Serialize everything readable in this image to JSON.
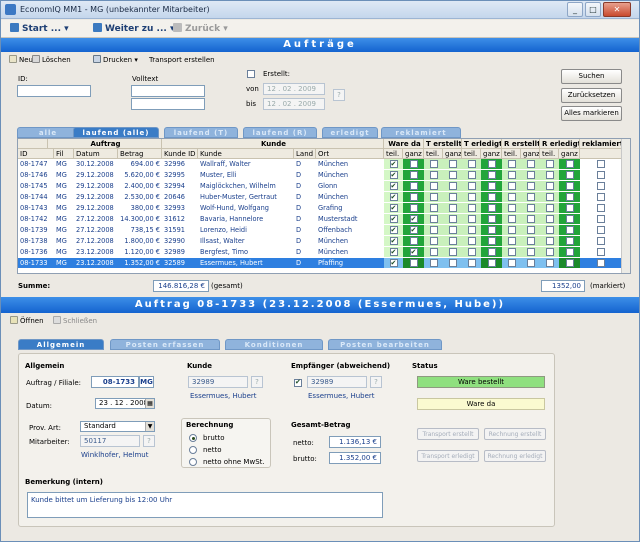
{
  "window": {
    "title": "EconomIQ MM1 - MG (unbekannter Mitarbeiter)",
    "min": "_",
    "max": "□",
    "close": "✕"
  },
  "nav": {
    "start": "Start ...",
    "weiter": "Weiter zu ...",
    "zurueck": "Zurück"
  },
  "band1": "Aufträge",
  "toolbar": {
    "neu": "Neu",
    "loeschen": "Löschen",
    "drucken": "Drucken",
    "transport": "Transport erstellen"
  },
  "filter": {
    "id_label": "ID:",
    "volltext_label": "Volltext",
    "erstellt_label": "Erstellt:",
    "von_label": "von",
    "bis_label": "bis",
    "von_value": "12 . 02 . 2009",
    "bis_value": "12 . 02 . 2009",
    "q": "?",
    "suchen": "Suchen",
    "zuruecksetzen": "Zurücksetzen",
    "alle_markieren": "Alles markieren"
  },
  "tabs": [
    "alle",
    "laufend (alle)",
    "laufend (T)",
    "laufend (R)",
    "erledigt",
    "reklamiert"
  ],
  "grid": {
    "groups": {
      "auftrag": "Auftrag",
      "kunde": "Kunde",
      "ware_da": "Ware da",
      "terstellt": "T erstellt",
      "terledigt": "T erledigt",
      "rerstellt": "R erstellt",
      "rerledigt": "R erledigt",
      "reklamiert": "reklamiert"
    },
    "cols": {
      "id": "ID",
      "fil": "Fil",
      "datum": "Datum",
      "betrag": "Betrag",
      "kunde_id": "Kunde ID",
      "kunde": "Kunde",
      "land": "Land",
      "ort": "Ort",
      "teil": "teil.",
      "ganz": "ganz",
      "teil2": "teil."
    },
    "rows": [
      {
        "id": "08-1747",
        "fil": "MG",
        "datum": "30.12.2008",
        "betrag": "694.00 €",
        "kid": "32996",
        "kunde": "Wallraff, Walter",
        "land": "D",
        "ort": "München",
        "checks": [
          1,
          0,
          0,
          0,
          0,
          0,
          0,
          0,
          0,
          0,
          0
        ],
        "sel": false
      },
      {
        "id": "08-1746",
        "fil": "MG",
        "datum": "29.12.2008",
        "betrag": "5.620,00 €",
        "kid": "32995",
        "kunde": "Muster, Elli",
        "land": "D",
        "ort": "München",
        "checks": [
          1,
          0,
          0,
          0,
          0,
          0,
          0,
          0,
          0,
          0,
          0
        ],
        "sel": false
      },
      {
        "id": "08-1745",
        "fil": "MG",
        "datum": "29.12.2008",
        "betrag": "2.400,00 €",
        "kid": "32994",
        "kunde": "Maiglöckchen, Wilhelm",
        "land": "D",
        "ort": "Glonn",
        "checks": [
          1,
          0,
          0,
          0,
          0,
          0,
          0,
          0,
          0,
          0,
          0
        ],
        "sel": false
      },
      {
        "id": "08-1744",
        "fil": "MG",
        "datum": "29.12.2008",
        "betrag": "2.530,00 €",
        "kid": "20646",
        "kunde": "Huber-Muster, Gertraut",
        "land": "D",
        "ort": "München",
        "checks": [
          1,
          0,
          0,
          0,
          0,
          0,
          0,
          0,
          0,
          0,
          0
        ],
        "sel": false
      },
      {
        "id": "08-1743",
        "fil": "MG",
        "datum": "29.12.2008",
        "betrag": "380,00 €",
        "kid": "32993",
        "kunde": "Wolf-Hund, Wolfgang",
        "land": "D",
        "ort": "Grafing",
        "checks": [
          1,
          0,
          0,
          0,
          0,
          0,
          0,
          0,
          0,
          0,
          0
        ],
        "sel": false
      },
      {
        "id": "08-1742",
        "fil": "MG",
        "datum": "27.12.2008",
        "betrag": "14.300,00 €",
        "kid": "31612",
        "kunde": "Bavaria, Hannelore",
        "land": "D",
        "ort": "Musterstadt",
        "checks": [
          1,
          1,
          0,
          0,
          0,
          0,
          0,
          0,
          0,
          0,
          0
        ],
        "sel": false
      },
      {
        "id": "08-1739",
        "fil": "MG",
        "datum": "27.12.2008",
        "betrag": "738,15 €",
        "kid": "31591",
        "kunde": "Lorenzo, Heidi",
        "land": "D",
        "ort": "Offenbach",
        "checks": [
          1,
          1,
          0,
          0,
          0,
          0,
          0,
          0,
          0,
          0,
          0
        ],
        "sel": false
      },
      {
        "id": "08-1738",
        "fil": "MG",
        "datum": "27.12.2008",
        "betrag": "1.800,00 €",
        "kid": "32990",
        "kunde": "Illsast, Walter",
        "land": "D",
        "ort": "München",
        "checks": [
          1,
          0,
          0,
          0,
          0,
          0,
          0,
          0,
          0,
          0,
          0
        ],
        "sel": false
      },
      {
        "id": "08-1736",
        "fil": "MG",
        "datum": "23.12.2008",
        "betrag": "1.120,00 €",
        "kid": "32989",
        "kunde": "Bergfest, Timo",
        "land": "D",
        "ort": "München",
        "checks": [
          1,
          1,
          0,
          0,
          0,
          0,
          0,
          0,
          0,
          0,
          0
        ],
        "sel": false
      },
      {
        "id": "08-1733",
        "fil": "MG",
        "datum": "23.12.2008",
        "betrag": "1.352,00 €",
        "kid": "32589",
        "kunde": "Essermues, Hubert",
        "land": "D",
        "ort": "Pfaffing",
        "checks": [
          1,
          0,
          0,
          0,
          0,
          0,
          0,
          0,
          0,
          0,
          0
        ],
        "sel": true
      }
    ]
  },
  "summe": {
    "label": "Summe:",
    "value": "146.816,28 €",
    "gesamt": "(gesamt)",
    "marked_value": "1352,00",
    "markiert": "(markiert)"
  },
  "band2": "Auftrag 08-1733 (23.12.2008 (Essermues, Hube))",
  "toolbar2": {
    "oeffnen": "Öffnen",
    "schliessen": "Schließen"
  },
  "tabs2": [
    "Allgemein",
    "Posten erfassen",
    "Konditionen",
    "Posten bearbeiten"
  ],
  "detail": {
    "allgemein": "Allgemein",
    "auftrag_label": "Auftrag / Filiale:",
    "auftrag_id": "08-1733",
    "filiale": "MG",
    "datum_label": "Datum:",
    "datum_value": "23 . 12 . 2008",
    "prov_label": "Prov. Art:",
    "prov_value": "Standard",
    "mitarbeiter_label": "Mitarbeiter:",
    "mitarbeiter_id": "50117",
    "mitarbeiter_name": "Winklhofer, Helmut",
    "kunde_head": "Kunde",
    "kunde_id": "32989",
    "kunde_name": "Essermues, Hubert",
    "empf_head": "Empfänger (abweichend)",
    "empf_id": "32989",
    "empf_name": "Essermues, Hubert",
    "berechnung": "Berechnung",
    "brutto": "brutto",
    "netto": "netto",
    "netto_mwst": "netto ohne MwSt.",
    "gesamt_head": "Gesamt-Betrag",
    "netto_label": "netto:",
    "netto_value": "1.136,13 €",
    "brutto_label": "brutto:",
    "brutto_value": "1.352,00 €",
    "status_head": "Status",
    "status1": "Ware bestellt",
    "status2": "Ware da",
    "transport_erstellt": "Transport erstellt",
    "rechnung_erstellt": "Rechnung erstellt",
    "transport_erledigt": "Transport erledigt",
    "rechnung_erledigt": "Rechnung erledigt",
    "bemerkung_head": "Bemerkung (intern)",
    "bemerkung": "Kunde bittet um Lieferung bis 12:00 Uhr"
  },
  "colors": {
    "accent": "#1463cf",
    "green": "#8fe07f",
    "yellow": "#fafad0"
  }
}
